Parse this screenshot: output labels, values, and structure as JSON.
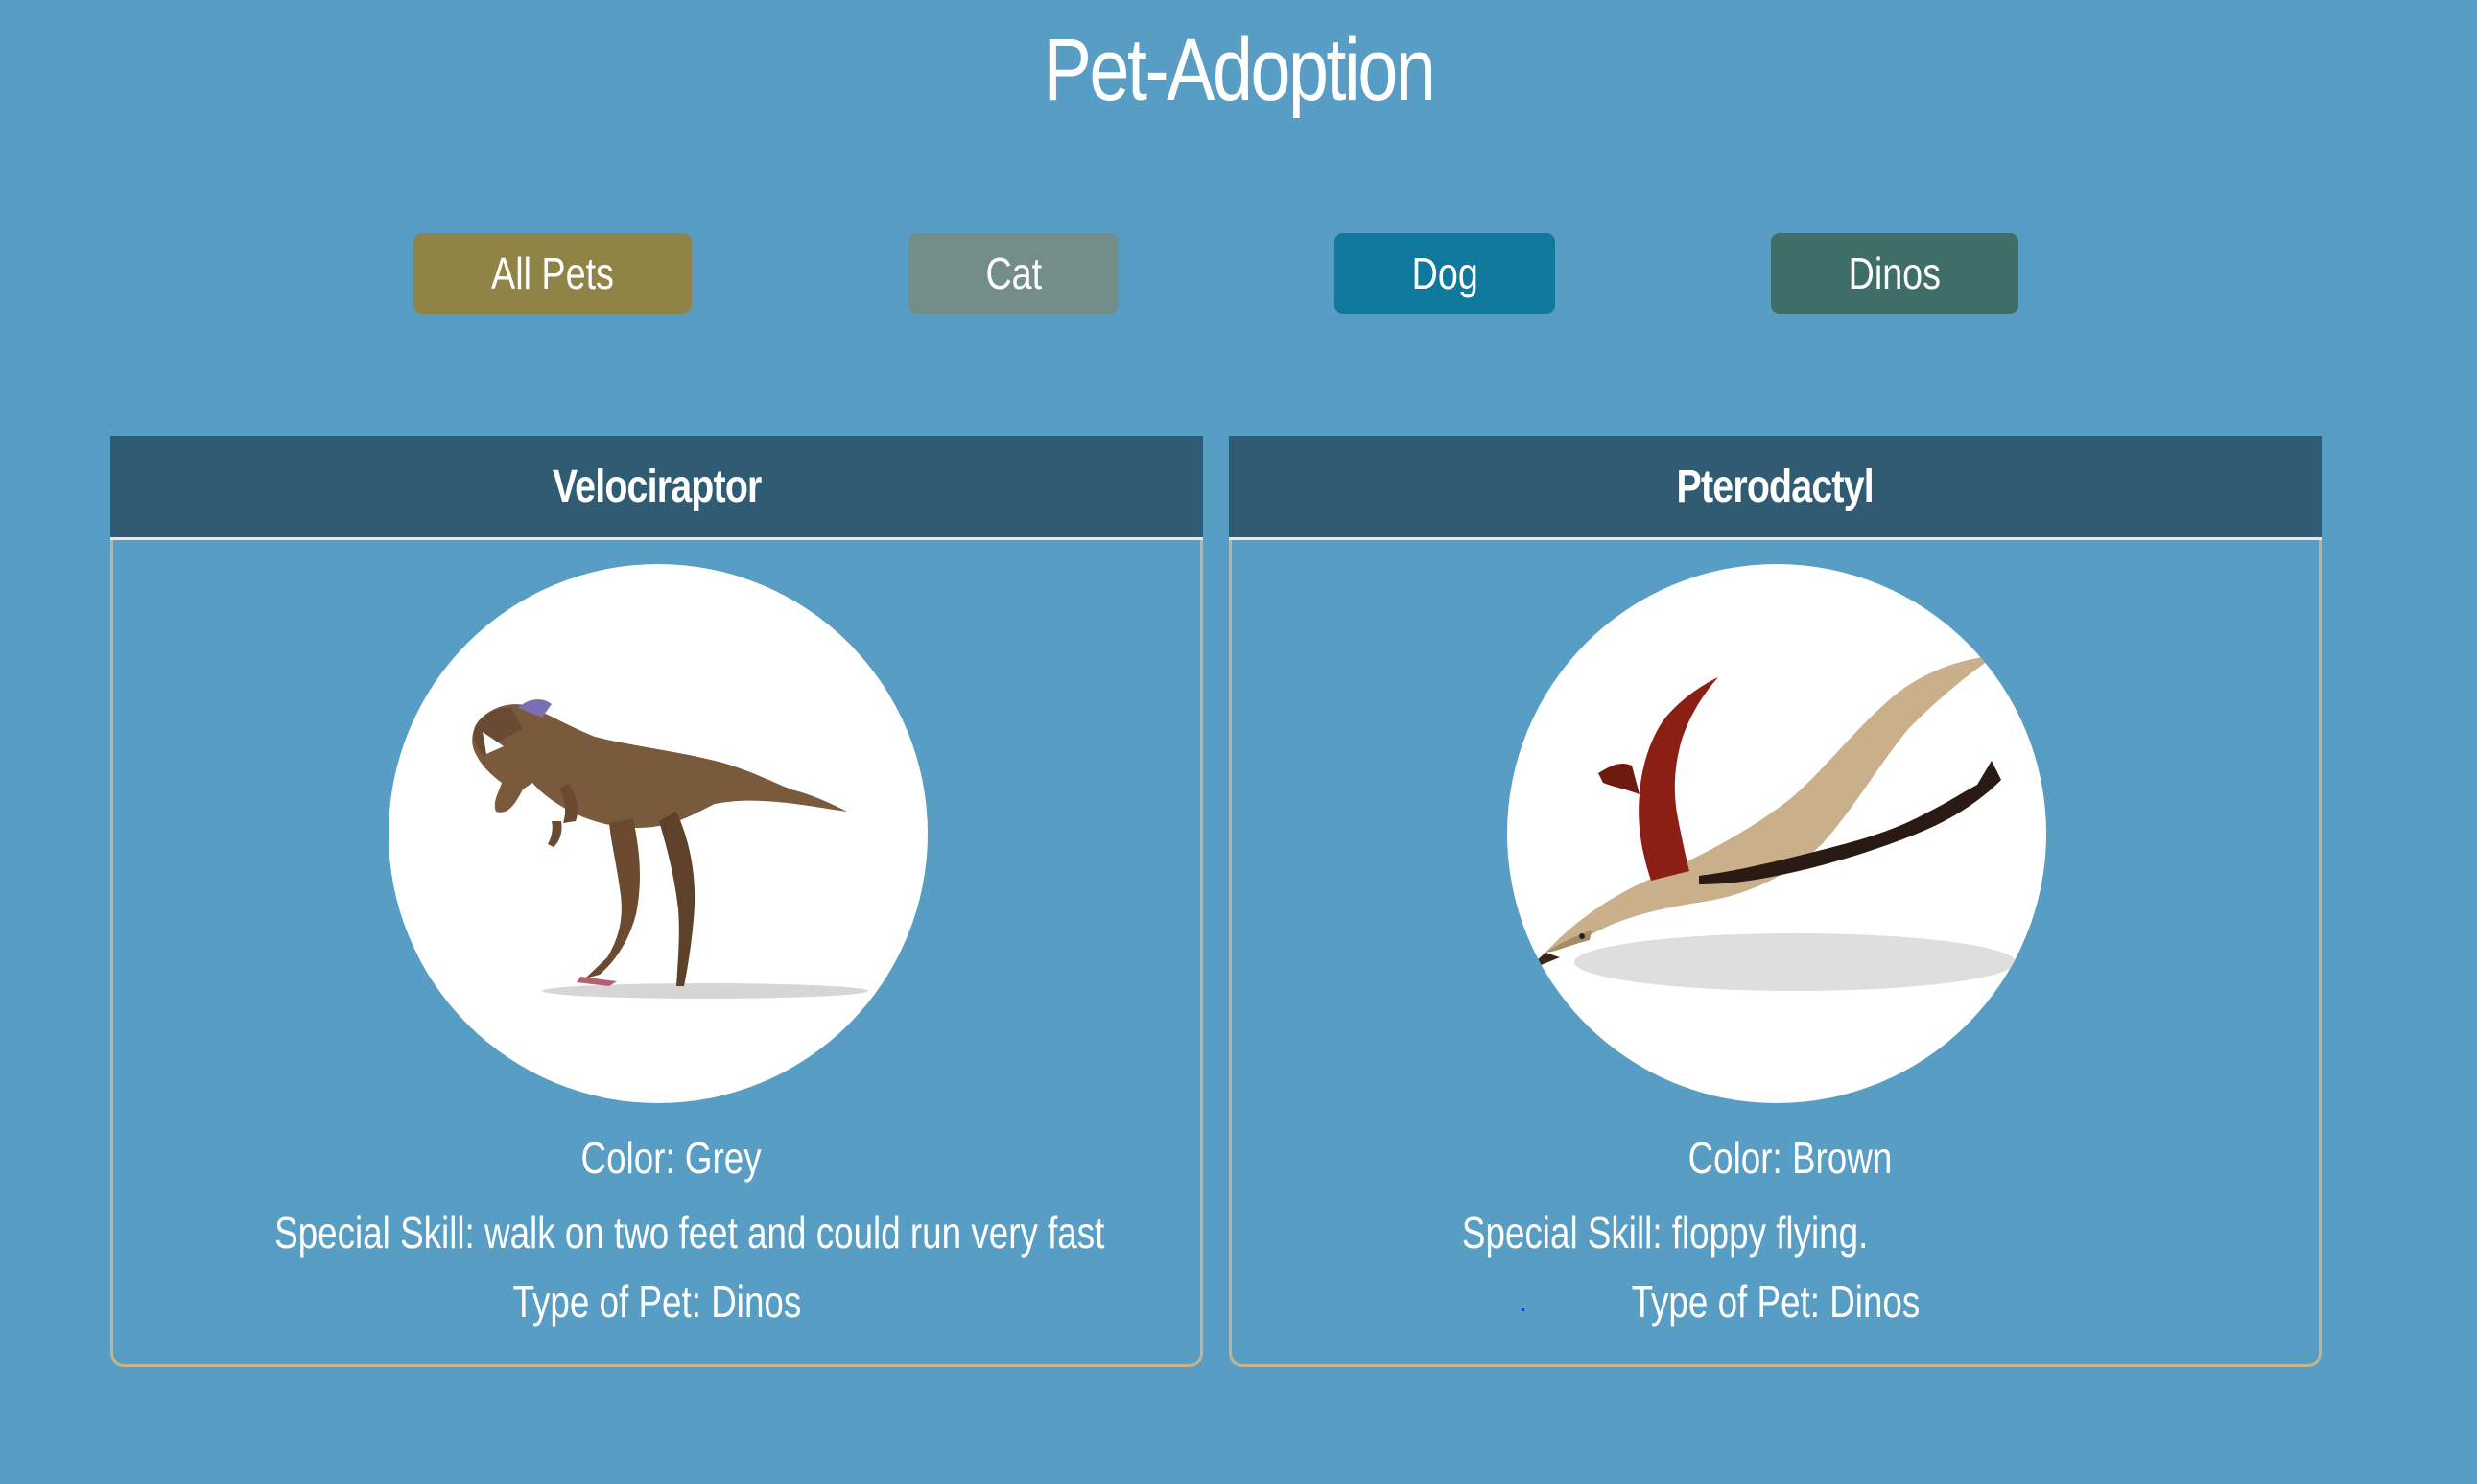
{
  "page": {
    "title": "Pet-Adoption"
  },
  "filters": [
    {
      "label": "All Pets",
      "color": "#8f8446"
    },
    {
      "label": "Cat",
      "color": "#738d8b"
    },
    {
      "label": "Dog",
      "color": "#10789c"
    },
    {
      "label": "Dinos",
      "color": "#3f6d67"
    }
  ],
  "pets": [
    {
      "name": "Velociraptor",
      "image_icon": "velociraptor-photo",
      "color_text": "Color: Grey",
      "skill_text": "Special Skill: walk on two feet and could run very fast",
      "type_text": "Type of Pet: Dinos"
    },
    {
      "name": "Pterodactyl",
      "image_icon": "pterodactyl-photo",
      "color_text": "Color: Brown",
      "skill_text": "Special Skill: floppy flying.",
      "type_text": "Type of Pet: Dinos"
    }
  ],
  "theme": {
    "background": "#589dc4",
    "card_header": "#2f5b73",
    "card_border": "#c6b28c"
  }
}
